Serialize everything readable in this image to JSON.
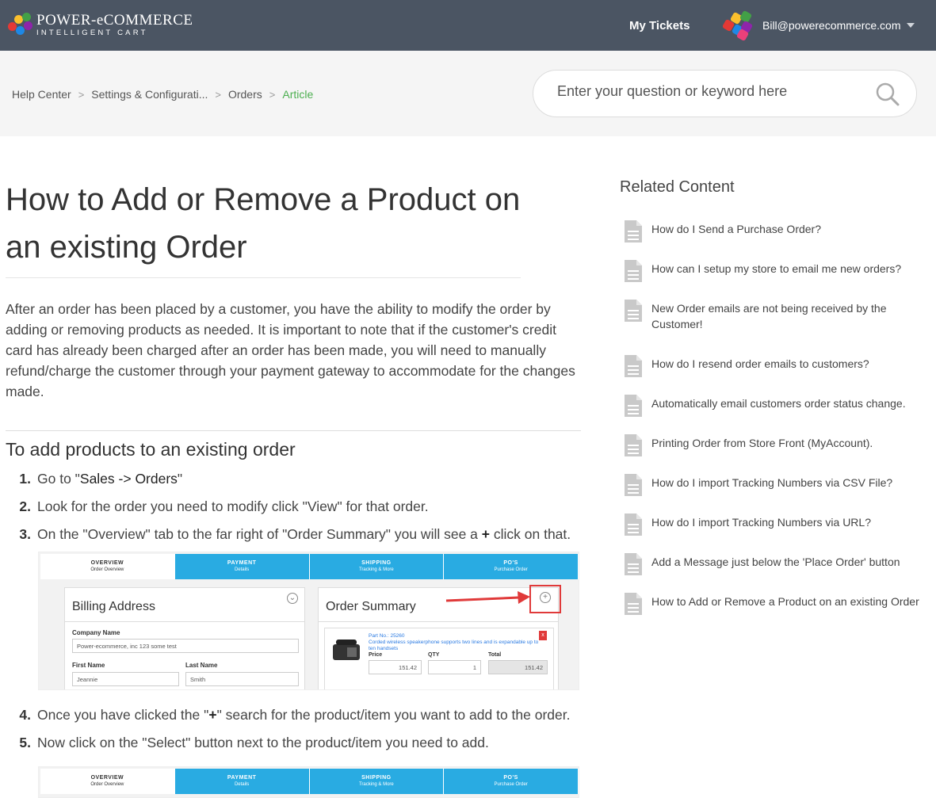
{
  "header": {
    "logo_title": "POWER-eCOMMERCE",
    "logo_sub": "INTELLIGENT CART",
    "nav_tickets": "My Tickets",
    "user_email": "Bill@powerecommerce.com"
  },
  "breadcrumb": {
    "items": [
      "Help Center",
      "Settings & Configurati...",
      "Orders"
    ],
    "active": "Article",
    "separator": ">"
  },
  "search": {
    "placeholder": "Enter your question or keyword here"
  },
  "article": {
    "title": "How to Add or Remove a Product on an existing Order",
    "intro": "After an order has been placed by a customer, you have the ability to modify the order by adding or removing products as needed. It is important to note that if the customer's credit card has already been charged after an order has been made, you will need to manually refund/charge the customer through your payment gateway to accommodate for the changes made.",
    "section_title": "To add products to an existing order",
    "steps": [
      {
        "num": "1.",
        "pre": "Go to \"",
        "strong": "Sales -> Orders",
        "post": "\""
      },
      {
        "num": "2.",
        "pre": "Look for the order you need to modify click \"View\" for that order.",
        "strong": "",
        "post": ""
      },
      {
        "num": "3.",
        "pre": "On the \"Overview\" tab to the far right of \"Order Summary\" you will see a ",
        "strong": "+",
        "post": " click on that."
      },
      {
        "num": "4.",
        "pre": "Once you have clicked the \"",
        "strong": "+",
        "post": "\" search for the product/item you want to add to the order."
      },
      {
        "num": "5.",
        "pre": "Now click on the \"Select\" button next to the product/item you need to add.",
        "strong": "",
        "post": ""
      }
    ]
  },
  "figure": {
    "tabs": [
      {
        "title": "OVERVIEW",
        "sub": "Order Overview"
      },
      {
        "title": "PAYMENT",
        "sub": "Details"
      },
      {
        "title": "SHIPPING",
        "sub": "Tracking & More"
      },
      {
        "title": "PO'S",
        "sub": "Purchase Order"
      }
    ],
    "billing_title": "Billing Address",
    "company_label": "Company Name",
    "company_value": "Power-ecommerce, inc 123 some test",
    "first_label": "First Name",
    "first_value": "Jeannie",
    "last_label": "Last Name",
    "last_value": "Smith",
    "summary_title": "Order Summary",
    "part_no": "Part No.: 25260",
    "product_desc": "Corded wireless speakerphone supports two lines and is expandable up to ten handsets",
    "price_label": "Price",
    "qty_label": "QTY",
    "total_label": "Total",
    "price_value": "151.42",
    "qty_value": "1",
    "total_value": "151.42",
    "remove_label": "x",
    "plus_label": "+"
  },
  "related": {
    "title": "Related Content",
    "items": [
      "How do I Send a Purchase Order?",
      "How can I setup my store to email me new orders?",
      "New Order emails are not being received by the Customer!",
      "How do I resend order emails to customers?",
      "Automatically email customers order status change.",
      "Printing Order from Store Front (MyAccount).",
      "How do I import Tracking Numbers via CSV File?",
      "How do I import Tracking Numbers via URL?",
      "Add a Message just below the 'Place Order' button",
      "How to Add or Remove a Product on an existing Order"
    ]
  },
  "colors": {
    "header_bg": "#4b5563",
    "accent_green": "#4caf50",
    "tab_blue": "#29abe2",
    "highlight_red": "#e03a3a"
  }
}
